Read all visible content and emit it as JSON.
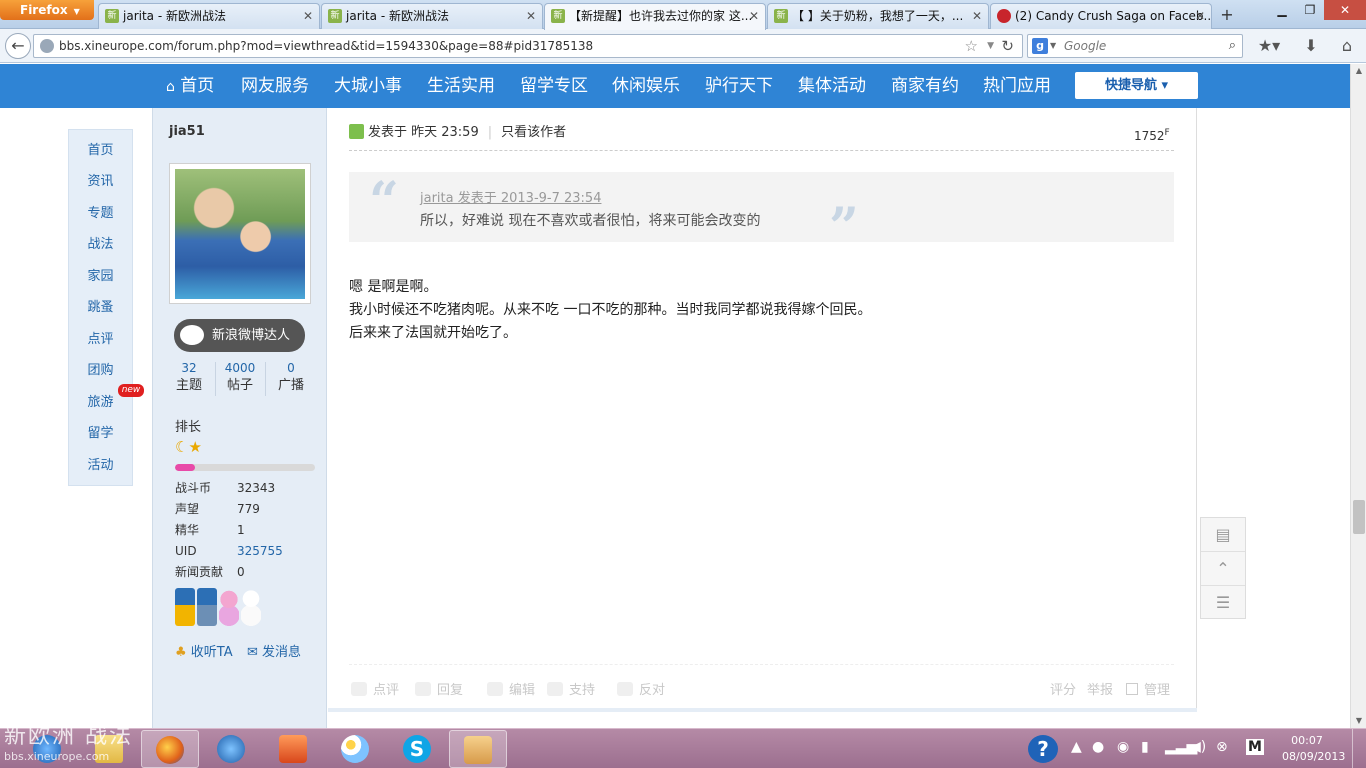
{
  "browser": {
    "menu_label": "Firefox",
    "tabs": [
      {
        "title": "jarita - 新欧洲战法"
      },
      {
        "title": "jarita - 新欧洲战法"
      },
      {
        "title": "【新提醒】也许我去过你的家 这..."
      },
      {
        "title": "【      】关于奶粉，我想了一天，..."
      },
      {
        "title": "(2) Candy Crush Saga on Faceb..."
      }
    ],
    "url": "bbs.xineurope.com/forum.php?mod=viewthread&tid=1594330&page=88#pid31785138",
    "search_placeholder": "Google"
  },
  "sitenav": {
    "items": [
      "首页",
      "网友服务",
      "大城小事",
      "生活实用",
      "留学专区",
      "休闲娱乐",
      "驴行天下",
      "集体活动",
      "商家有约",
      "热门应用"
    ],
    "quick_nav": "快捷导航 ▾"
  },
  "sidenav": {
    "items": [
      "首页",
      "资讯",
      "专题",
      "战法",
      "家园",
      "跳蚤",
      "点评",
      "团购",
      "旅游",
      "留学",
      "活动"
    ],
    "badge": "new"
  },
  "author": {
    "name": "jia51",
    "weibo_badge": "新浪微博达人",
    "stats": [
      {
        "num": "32",
        "label": "主题"
      },
      {
        "num": "4000",
        "label": "帖子"
      },
      {
        "num": "0",
        "label": "广播"
      }
    ],
    "rank": "排长",
    "level_fraction": 0.14,
    "info": [
      {
        "k": "战斗币",
        "v": "32343"
      },
      {
        "k": "声望",
        "v": "779"
      },
      {
        "k": "精华",
        "v": "1"
      },
      {
        "k": "UID",
        "v": "325755"
      },
      {
        "k": "新闻贡献",
        "v": "0"
      }
    ],
    "follow": "收听TA",
    "message": "发消息"
  },
  "post": {
    "posted": "发表于 昨天 23:59",
    "only_author": "只看该作者",
    "floor": "1752",
    "floor_suffix": "F",
    "quote": {
      "author": "jarita 发表于 2013-9-7 23:54",
      "text": "所以，好难说 现在不喜欢或者很怕，将来可能会改变的"
    },
    "lines": [
      "嗯 是啊是啊。",
      "我小时候还不吃猪肉呢。从来不吃 一口不吃的那种。当时我同学都说我得嫁个回民。",
      "后来来了法国就开始吃了。"
    ],
    "actions": [
      "点评",
      "回复",
      "编辑",
      "支持",
      "反对"
    ],
    "admin_actions": [
      "评分",
      "举报",
      "管理"
    ]
  },
  "watermark": {
    "title": "新欧洲 战法",
    "url": "bbs.xineurope.com"
  },
  "taskbar": {
    "clock_time": "00:07",
    "clock_date": "08/09/2013"
  },
  "colors": {
    "site_blue": "#2f84d5",
    "link_blue": "#2366a8",
    "author_bg": "#e5edf6",
    "taskbar": "#9c6f8f"
  }
}
